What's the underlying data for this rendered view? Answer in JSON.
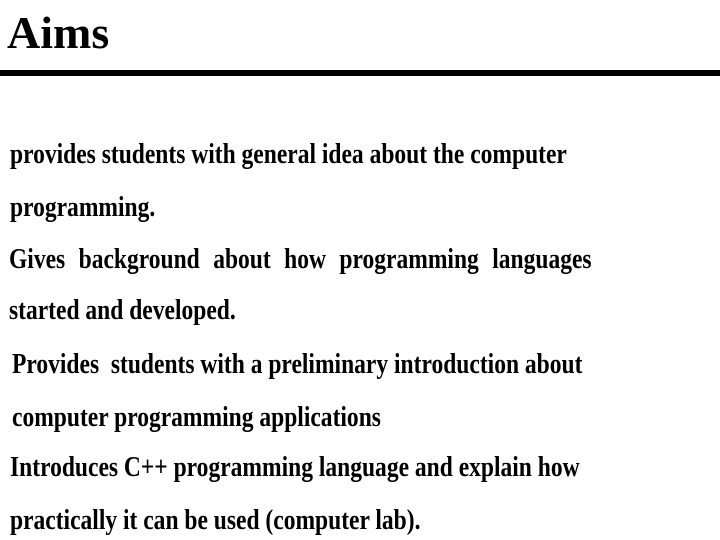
{
  "slide": {
    "title": "Aims",
    "bullets": [
      {
        "lines": [
          "provides students with general idea about the computer",
          "programming."
        ]
      },
      {
        "lines": [
          "Gives background about how programming languages",
          "started and developed."
        ]
      },
      {
        "lines": [
          "Provides  students with a preliminary introduction about",
          "computer programming applications"
        ]
      },
      {
        "lines": [
          "Introduces C++ programming language and explain how",
          "practically it can be used (computer lab)."
        ]
      }
    ]
  }
}
